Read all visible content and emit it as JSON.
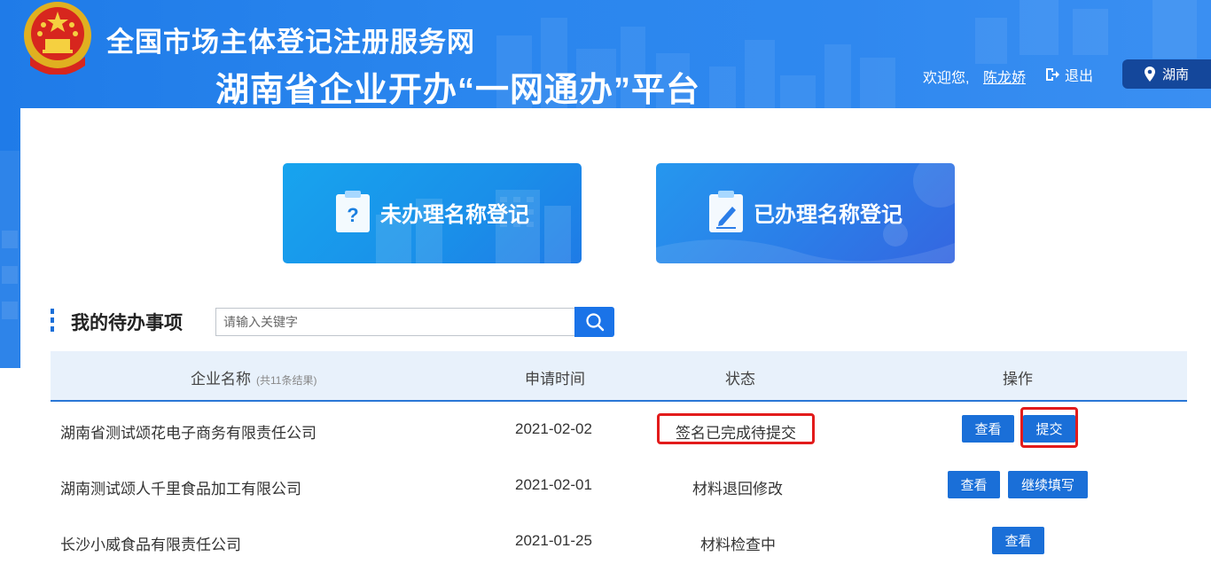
{
  "header": {
    "title_line1": "全国市场主体登记注册服务网",
    "title_line2": "湖南省企业开办“一网通办”平台",
    "welcome_text": "欢迎您,",
    "username": "陈龙娇",
    "logout_label": "退出",
    "region_label": "湖南"
  },
  "cards": [
    {
      "label": "未办理名称登记",
      "icon": "clipboard-question-icon"
    },
    {
      "label": "已办理名称登记",
      "icon": "clipboard-edit-icon"
    }
  ],
  "todo": {
    "section_title": "我的待办事项",
    "search_placeholder": "请输入关键字",
    "columns": {
      "company": "企业名称",
      "result_count": "(共11条结果)",
      "date": "申请时间",
      "status": "状态",
      "actions": "操作"
    },
    "rows": [
      {
        "company": "湖南省测试颂花电子商务有限责任公司",
        "date": "2021-02-02",
        "status": "签名已完成待提交",
        "actions": [
          "查看",
          "提交"
        ]
      },
      {
        "company": "湖南测试颂人千里食品加工有限公司",
        "date": "2021-02-01",
        "status": "材料退回修改",
        "actions": [
          "查看",
          "继续填写"
        ]
      },
      {
        "company": "长沙小威食品有限责任公司",
        "date": "2021-01-25",
        "status": "材料检查中",
        "actions": [
          "查看"
        ]
      }
    ]
  },
  "colors": {
    "primary": "#1a6fd8",
    "banner": "#2a86ee",
    "region_bg": "#14479b",
    "table_header_bg": "#e8f1fb",
    "highlight": "#e21b1b"
  }
}
